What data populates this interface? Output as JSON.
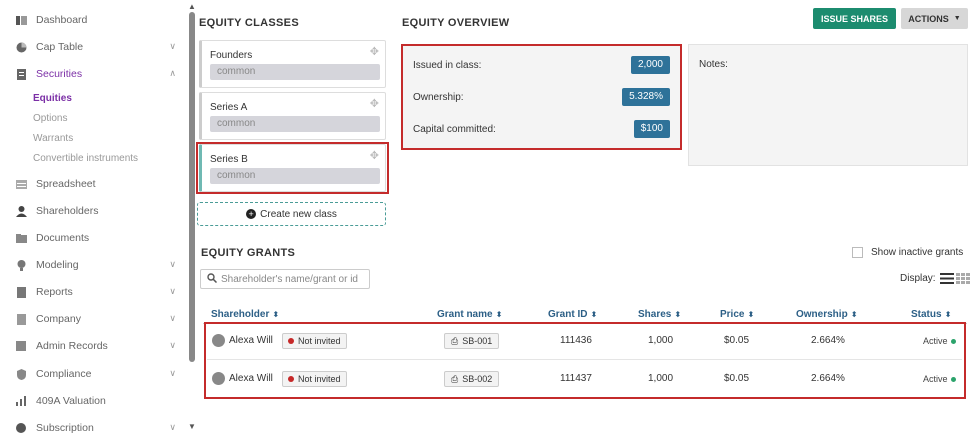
{
  "sidebar": {
    "items": [
      {
        "label": "Dashboard",
        "icon": "dashboard-icon"
      },
      {
        "label": "Cap Table",
        "icon": "pie-chart-icon"
      },
      {
        "label": "Securities",
        "icon": "document-icon"
      },
      {
        "label": "Spreadsheet",
        "icon": "spreadsheet-icon"
      },
      {
        "label": "Shareholders",
        "icon": "person-icon"
      },
      {
        "label": "Documents",
        "icon": "folder-icon"
      },
      {
        "label": "Modeling",
        "icon": "lightbulb-icon"
      },
      {
        "label": "Reports",
        "icon": "report-icon"
      },
      {
        "label": "Company",
        "icon": "building-icon"
      },
      {
        "label": "Admin Records",
        "icon": "records-icon"
      },
      {
        "label": "Compliance",
        "icon": "shield-icon"
      },
      {
        "label": "409A Valuation",
        "icon": "valuation-icon"
      },
      {
        "label": "Subscription",
        "icon": "subscription-icon"
      }
    ],
    "sub_items": [
      "Equities",
      "Options",
      "Warrants",
      "Convertible instruments"
    ]
  },
  "equity_classes": {
    "title": "EQUITY CLASSES",
    "classes": [
      {
        "name": "Founders",
        "type": "common"
      },
      {
        "name": "Series A",
        "type": "common"
      },
      {
        "name": "Series B",
        "type": "common"
      }
    ],
    "create_label": "Create new class"
  },
  "overview": {
    "title": "EQUITY OVERVIEW",
    "issued_label": "Issued in class:",
    "issued_value": "2,000",
    "ownership_label": "Ownership:",
    "ownership_value": "5.328%",
    "capital_label": "Capital committed:",
    "capital_value": "$100",
    "notes_label": "Notes:"
  },
  "toolbar": {
    "issue_label": "ISSUE SHARES",
    "actions_label": "ACTIONS"
  },
  "grants": {
    "title": "EQUITY GRANTS",
    "search_placeholder": "Shareholder's name/grant or id",
    "show_inactive_label": "Show inactive grants",
    "display_label": "Display:",
    "columns": [
      "Shareholder",
      "Grant name",
      "Grant ID",
      "Shares",
      "Price",
      "Ownership",
      "Status"
    ],
    "rows": [
      {
        "shareholder": "Alexa Will",
        "invite": "Not invited",
        "grant_name": "SB-001",
        "grant_id": "111436",
        "shares": "1,000",
        "price": "$0.05",
        "ownership": "2.664%",
        "status": "Active"
      },
      {
        "shareholder": "Alexa Will",
        "invite": "Not invited",
        "grant_name": "SB-002",
        "grant_id": "111437",
        "shares": "1,000",
        "price": "$0.05",
        "ownership": "2.664%",
        "status": "Active"
      }
    ]
  },
  "colors": {
    "accent_purple": "#7b2fa6",
    "badge_blue": "#2e7299",
    "issue_green": "#1c8c6f",
    "highlight_red": "#c42b2b"
  }
}
